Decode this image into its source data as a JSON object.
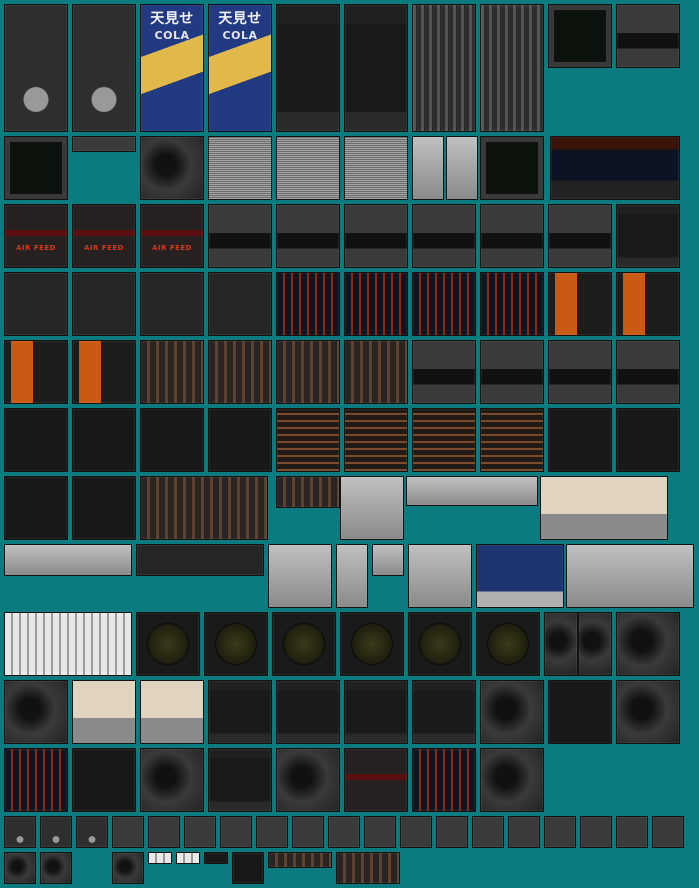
{
  "atlas": {
    "background": "#0a7b7e",
    "sprite_count": 131,
    "texts": {
      "vending_kanji": "天見せ",
      "vending_word": "COLA",
      "air_feed": "AIR FEED"
    },
    "themes": {
      "gauge": "#2e2e2e",
      "vending": "#18306a",
      "mixer": "#454545",
      "screen": "#0c130c",
      "static": "#555555",
      "cockpit": "#0c1424",
      "red": "#262020",
      "control": "#3a3a3a",
      "tall": "#202020",
      "blue": "#101522",
      "orange": "#1c1c1c",
      "silver": "#bdbdbd",
      "panel": "#262626",
      "brown": "#1e1814",
      "grid": "#221a15",
      "beige": "#d9cdb8",
      "wide": "#9a9a9a",
      "lcd": "#1c3470",
      "radar": "#1a1a1a",
      "damage": "#303030",
      "dark": "#181818",
      "small": "#3a3a3a",
      "white": "#e8e8e8"
    }
  }
}
